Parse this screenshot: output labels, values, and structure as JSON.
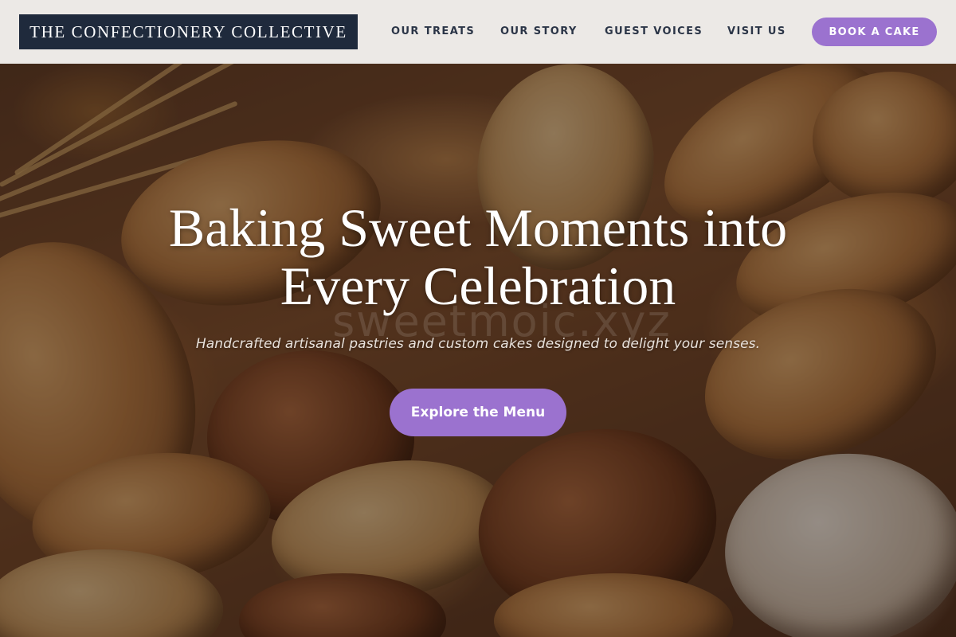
{
  "header": {
    "brand": "THE CONFECTIONERY COLLECTIVE",
    "nav": [
      {
        "label": "OUR TREATS"
      },
      {
        "label": "OUR STORY"
      },
      {
        "label": "GUEST VOICES"
      },
      {
        "label": "VISIT US"
      }
    ],
    "cta_label": "BOOK A CAKE"
  },
  "hero": {
    "title_line1": "Baking Sweet Moments into",
    "title_line2": "Every Celebration",
    "subtitle": "Handcrafted artisanal pastries and custom cakes designed to delight your senses.",
    "button_label": "Explore the Menu",
    "watermark": "sweetmoic.xyz",
    "background_image": "bread-basket-photo"
  },
  "colors": {
    "brand_navy": "#1f2a3c",
    "accent_purple": "#9b72cf",
    "nav_text": "#2b3547",
    "header_bg": "#f4f1ee"
  }
}
